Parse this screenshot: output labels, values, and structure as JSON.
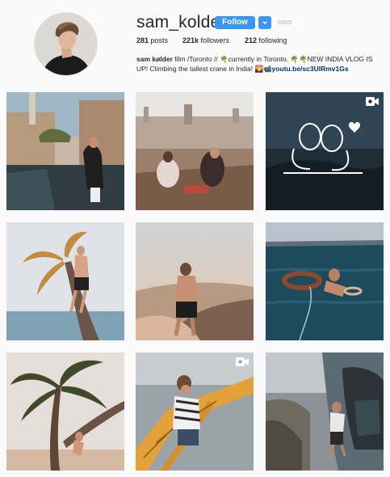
{
  "profile": {
    "username": "sam_kolder",
    "follow_label": "Follow",
    "stats": {
      "posts_count": "281",
      "posts_label": "posts",
      "followers_count": "221k",
      "followers_label": "followers",
      "following_count": "212",
      "following_label": "following"
    },
    "bio": {
      "name": "sam kølder",
      "line1": " film /Toronto // 🌴currently in Toronto. 🌴🌴NEW INDIA VLOG IS",
      "line2": "UP! Climbing the tallest crane in India! 🌄📹",
      "link": "youtu.be/sc3UIRmv1Gs"
    }
  },
  "posts": [
    {
      "scene": "desert palace poolside",
      "type": "image"
    },
    {
      "scene": "rooftop picnic couple",
      "type": "image"
    },
    {
      "scene": "doodle couple on rock",
      "type": "video"
    },
    {
      "scene": "climbing palm tree at sea",
      "type": "image"
    },
    {
      "scene": "sunset sand dunes",
      "type": "image"
    },
    {
      "scene": "floating on inner tube",
      "type": "image"
    },
    {
      "scene": "palm tree on beach",
      "type": "image"
    },
    {
      "scene": "climbing yellow crane",
      "type": "video"
    },
    {
      "scene": "helicopter over gorge",
      "type": "image"
    }
  ],
  "colors": {
    "accent": "#3897f0",
    "link": "#003569",
    "text": "#262626",
    "background": "#fafafa"
  },
  "icons": {
    "video": "video-camera-icon",
    "dropdown": "chevron-down-icon",
    "more": "more-options-icon"
  }
}
